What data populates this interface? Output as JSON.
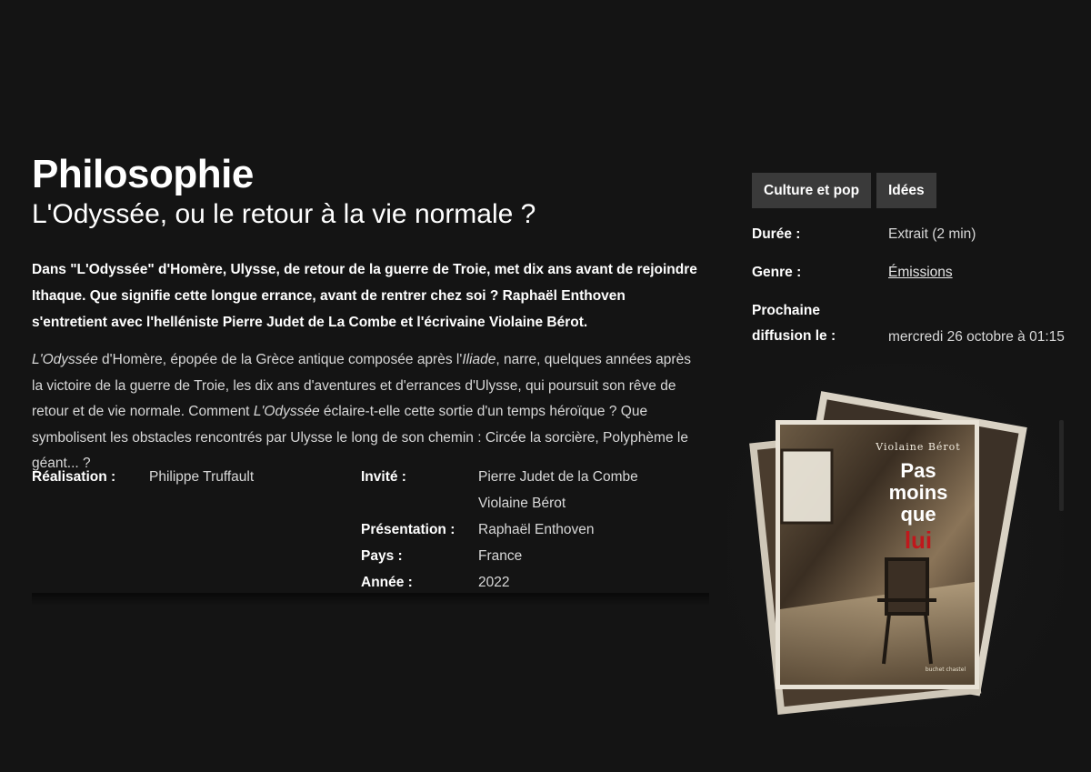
{
  "program": {
    "title": "Philosophie",
    "subtitle": "L'Odyssée, ou le retour à la vie normale ?",
    "lead": "Dans \"L'Odyssée\" d'Homère, Ulysse, de retour de la guerre de Troie, met dix ans avant de rejoindre Ithaque. Que signifie cette longue errance, avant de rentrer chez soi ? Raphaël Enthoven s'entretient avec l'helléniste Pierre Judet de La Combe et l'écrivaine Violaine Bérot.",
    "body": {
      "italic_1": "L'Odyssée",
      "text_1": " d'Homère, épopée de la Grèce antique composée après l'",
      "italic_2": "Iliade",
      "text_2": ", narre, quelques années après la victoire de la guerre de Troie, les dix ans d'aventures et d'errances d'Ulysse, qui poursuit son rêve de retour et de vie normale. Comment ",
      "italic_3": "L'Odyssée",
      "text_3": " éclaire-t-elle cette sortie d'un temps héroïque ? Que symbolisent les obstacles rencontrés par Ulysse le long de son chemin : Circée la sorcière, Polyphème le géant... ?"
    }
  },
  "credits": {
    "realisation_label": "Réalisation :",
    "realisation_value": "Philippe Truffault",
    "invite_label": "Invité :",
    "invite_values": [
      "Pierre Judet de la Combe",
      "Violaine Bérot"
    ],
    "presentation_label": "Présentation :",
    "presentation_value": "Raphaël Enthoven",
    "pays_label": "Pays :",
    "pays_value": "France",
    "annee_label": "Année :",
    "annee_value": "2022"
  },
  "tags": [
    "Culture et pop",
    "Idées"
  ],
  "meta": {
    "duree_label": "Durée :",
    "duree_value": "Extrait (2 min)",
    "genre_label": "Genre :",
    "genre_value": "Émissions",
    "diffusion_label_1": "Prochaine",
    "diffusion_label_2": "diffusion le :",
    "diffusion_value": "mercredi 26 octobre à 01:15"
  },
  "cover": {
    "author": "Violaine Bérot",
    "title_1": "Pas",
    "title_2": "moins",
    "title_3": "que",
    "title_4": "lui",
    "publisher": "buchet chastel"
  },
  "colors": {
    "background": "#141414",
    "tag_bg": "#3a3a3a",
    "cover_accent": "#c0181c"
  }
}
